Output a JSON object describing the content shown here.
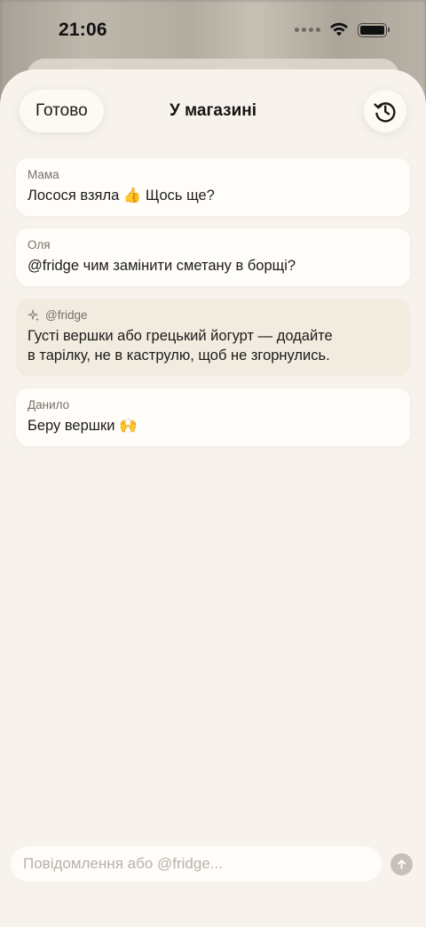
{
  "status_bar": {
    "time": "21:06"
  },
  "header": {
    "done_label": "Готово",
    "title": "У магазині",
    "history_icon": "history-icon"
  },
  "messages": [
    {
      "author": "Мама",
      "text_before": "Лосося взяла",
      "emoji": "👍",
      "text_after": "Щось ще?",
      "kind": "user"
    },
    {
      "author": "Оля",
      "text": "@fridge чим замінити сметану в борщі?",
      "kind": "user"
    },
    {
      "author": "@fridge",
      "text_line1": "Густі вершки або грецький йогурт — додайте",
      "text_line2": "в тарілку, не в каструлю, щоб не згорнулись.",
      "kind": "bot",
      "icon": "sparkles-icon"
    },
    {
      "author": "Данило",
      "text": "Беру вершки",
      "emoji": "🙌",
      "kind": "user"
    }
  ],
  "composer": {
    "placeholder": "Повідомлення або @fridge...",
    "send_icon": "arrow-up-icon"
  },
  "colors": {
    "sheet_bg": "#f7f3ec",
    "card_bg": "#fffdf9",
    "bot_card_bg": "#f1ebe0"
  }
}
